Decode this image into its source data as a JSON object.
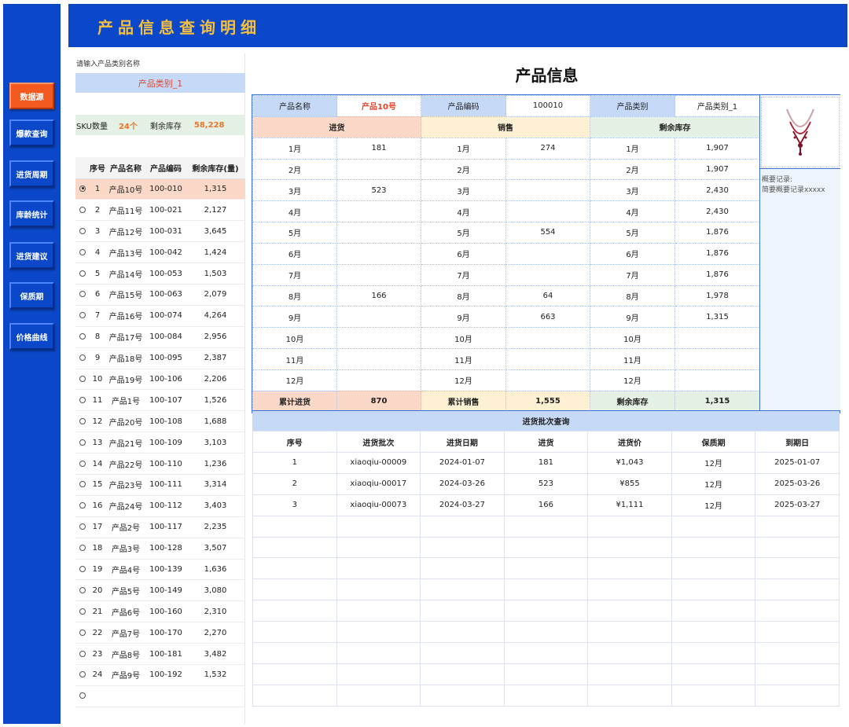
{
  "header": {
    "title": "产品信息查询明细"
  },
  "sidebar": {
    "items": [
      {
        "label": "数据源"
      },
      {
        "label": "爆款查询"
      },
      {
        "label": "进货周期"
      },
      {
        "label": "库龄统计"
      },
      {
        "label": "进货建议"
      },
      {
        "label": "保质期"
      },
      {
        "label": "价格曲线"
      }
    ]
  },
  "left": {
    "search_label": "请输入产品类别名称",
    "search_value": "产品类别_1",
    "sku_label": "SKU数量",
    "sku_count": "24个",
    "stock_label": "剩余库存",
    "stock_value": "58,228",
    "columns": [
      "序号",
      "产品名称",
      "产品编码",
      "剩余库存(量)"
    ],
    "rows": [
      {
        "no": "1",
        "name": "产品10号",
        "code": "100-010",
        "stock": "1,315",
        "selected": true
      },
      {
        "no": "2",
        "name": "产品11号",
        "code": "100-021",
        "stock": "2,127"
      },
      {
        "no": "3",
        "name": "产品12号",
        "code": "100-031",
        "stock": "3,645"
      },
      {
        "no": "4",
        "name": "产品13号",
        "code": "100-042",
        "stock": "1,424"
      },
      {
        "no": "5",
        "name": "产品14号",
        "code": "100-053",
        "stock": "1,503"
      },
      {
        "no": "6",
        "name": "产品15号",
        "code": "100-063",
        "stock": "2,079"
      },
      {
        "no": "7",
        "name": "产品16号",
        "code": "100-074",
        "stock": "4,264"
      },
      {
        "no": "8",
        "name": "产品17号",
        "code": "100-084",
        "stock": "2,956"
      },
      {
        "no": "9",
        "name": "产品18号",
        "code": "100-095",
        "stock": "2,387"
      },
      {
        "no": "10",
        "name": "产品19号",
        "code": "100-106",
        "stock": "2,206"
      },
      {
        "no": "11",
        "name": "产品1号",
        "code": "100-107",
        "stock": "1,526"
      },
      {
        "no": "12",
        "name": "产品20号",
        "code": "100-108",
        "stock": "1,688"
      },
      {
        "no": "13",
        "name": "产品21号",
        "code": "100-109",
        "stock": "3,103"
      },
      {
        "no": "14",
        "name": "产品22号",
        "code": "100-110",
        "stock": "1,236"
      },
      {
        "no": "15",
        "name": "产品23号",
        "code": "100-111",
        "stock": "3,314"
      },
      {
        "no": "16",
        "name": "产品24号",
        "code": "100-112",
        "stock": "3,403"
      },
      {
        "no": "17",
        "name": "产品2号",
        "code": "100-117",
        "stock": "2,235"
      },
      {
        "no": "18",
        "name": "产品3号",
        "code": "100-128",
        "stock": "3,507"
      },
      {
        "no": "19",
        "name": "产品4号",
        "code": "100-139",
        "stock": "1,636"
      },
      {
        "no": "20",
        "name": "产品5号",
        "code": "100-149",
        "stock": "3,080"
      },
      {
        "no": "21",
        "name": "产品6号",
        "code": "100-160",
        "stock": "2,310"
      },
      {
        "no": "22",
        "name": "产品7号",
        "code": "100-170",
        "stock": "2,270"
      },
      {
        "no": "23",
        "name": "产品8号",
        "code": "100-181",
        "stock": "3,482"
      },
      {
        "no": "24",
        "name": "产品9号",
        "code": "100-192",
        "stock": "1,532"
      },
      {
        "no": "",
        "name": "",
        "code": "",
        "stock": ""
      }
    ]
  },
  "detail": {
    "title": "产品信息",
    "name_label": "产品名称",
    "name_value": "产品10号",
    "code_label": "产品编码",
    "code_value": "100010",
    "category_label": "产品类别",
    "category_value": "产品类别_1",
    "purchase_label": "进货",
    "sales_label": "销售",
    "remaining_label": "剩余库存",
    "months": [
      {
        "m": "1月",
        "purchase": "181",
        "sales": "274",
        "remain": "1,907"
      },
      {
        "m": "2月",
        "purchase": "",
        "sales": "",
        "remain": "1,907"
      },
      {
        "m": "3月",
        "purchase": "523",
        "sales": "",
        "remain": "2,430"
      },
      {
        "m": "4月",
        "purchase": "",
        "sales": "",
        "remain": "2,430"
      },
      {
        "m": "5月",
        "purchase": "",
        "sales": "554",
        "remain": "1,876"
      },
      {
        "m": "6月",
        "purchase": "",
        "sales": "",
        "remain": "1,876"
      },
      {
        "m": "7月",
        "purchase": "",
        "sales": "",
        "remain": "1,876"
      },
      {
        "m": "8月",
        "purchase": "166",
        "sales": "64",
        "remain": "1,978"
      },
      {
        "m": "9月",
        "purchase": "",
        "sales": "663",
        "remain": "1,315"
      },
      {
        "m": "10月",
        "purchase": "",
        "sales": "",
        "remain": ""
      },
      {
        "m": "11月",
        "purchase": "",
        "sales": "",
        "remain": ""
      },
      {
        "m": "12月",
        "purchase": "",
        "sales": "",
        "remain": ""
      }
    ],
    "total_purchase_label": "累计进货",
    "total_purchase": "870",
    "total_sales_label": "累计销售",
    "total_sales": "1,555",
    "total_remaining_label": "剩余库存",
    "total_remaining": "1,315",
    "memo_title": "概要记录:",
    "memo_text": "简要概要记录xxxxx"
  },
  "batch": {
    "title": "进货批次查询",
    "columns": [
      "序号",
      "进货批次",
      "进货日期",
      "进货",
      "进货价",
      "保质期",
      "到期日"
    ],
    "rows": [
      [
        "1",
        "xiaoqiu-00009",
        "2024-01-07",
        "181",
        "¥1,043",
        "12月",
        "2025-01-07"
      ],
      [
        "2",
        "xiaoqiu-00017",
        "2024-03-26",
        "523",
        "¥855",
        "12月",
        "2025-03-26"
      ],
      [
        "3",
        "xiaoqiu-00073",
        "2024-03-27",
        "166",
        "¥1,111",
        "12月",
        "2025-03-27"
      ]
    ],
    "empty_rows": 9
  }
}
